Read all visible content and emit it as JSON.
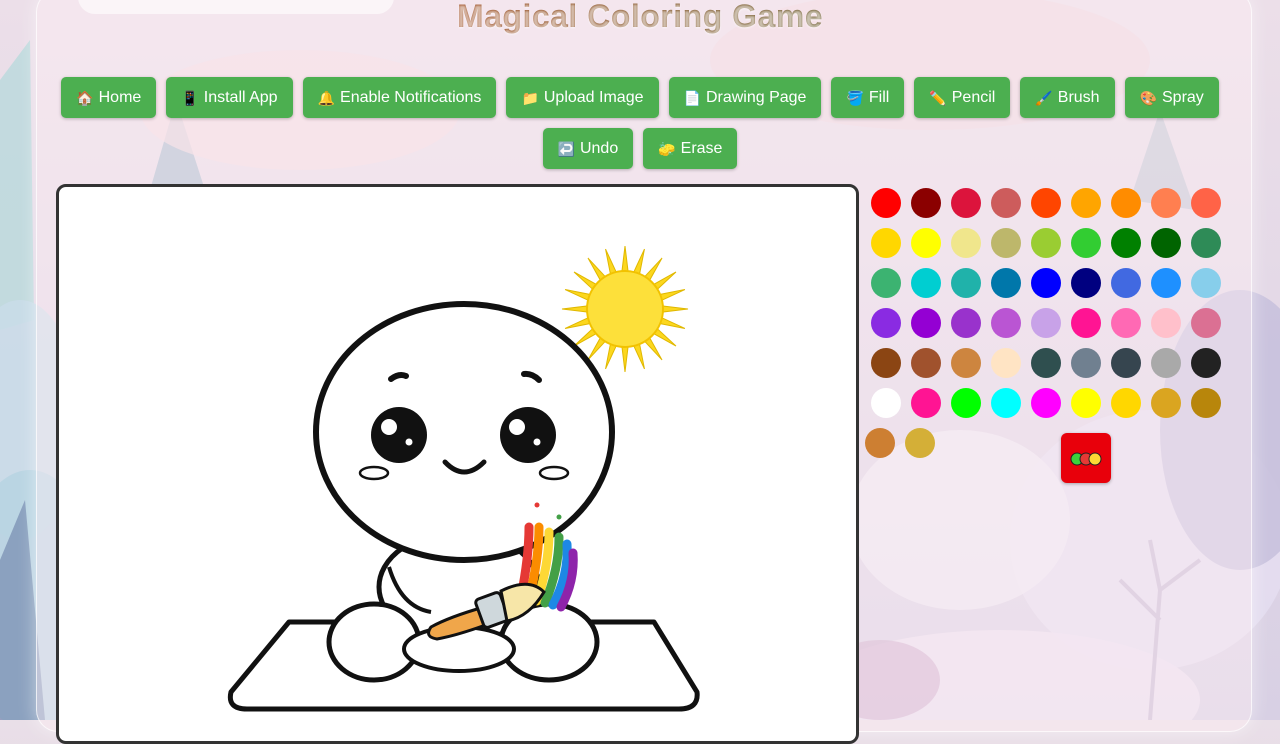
{
  "app": {
    "title": "Magical Coloring Game"
  },
  "toolbar": {
    "row1": [
      {
        "icon": "🏠",
        "icon_name": "house-icon",
        "label": "Home",
        "name": "home-button"
      },
      {
        "icon": "📱",
        "icon_name": "phone-icon",
        "label": "Install App",
        "name": "install-app-button"
      },
      {
        "icon": "🔔",
        "icon_name": "bell-icon",
        "label": "Enable Notifications",
        "name": "enable-notifications-button"
      },
      {
        "icon": "📁",
        "icon_name": "folder-icon",
        "label": "Upload Image",
        "name": "upload-image-button"
      },
      {
        "icon": "📄",
        "icon_name": "page-icon",
        "label": "Drawing Page",
        "name": "drawing-page-button"
      },
      {
        "icon": "🪣",
        "icon_name": "bucket-icon",
        "label": "Fill",
        "name": "fill-button"
      },
      {
        "icon": "✏️",
        "icon_name": "pencil-icon",
        "label": "Pencil",
        "name": "pencil-button"
      },
      {
        "icon": "🖌️",
        "icon_name": "brush-icon",
        "label": "Brush",
        "name": "brush-button"
      },
      {
        "icon": "🎨",
        "icon_name": "palette-icon",
        "label": "Spray",
        "name": "spray-button"
      }
    ],
    "row2": [
      {
        "icon": "↩️",
        "icon_name": "undo-icon",
        "label": "Undo",
        "name": "undo-button"
      },
      {
        "icon": "🧽",
        "icon_name": "sponge-icon",
        "label": "Erase",
        "name": "erase-button"
      }
    ]
  },
  "palette": {
    "colors": [
      "#ff0000",
      "#8b0000",
      "#dc143c",
      "#cd5c5c",
      "#ff4500",
      "#ffa500",
      "#ff8c00",
      "#ff7f50",
      "#ff6347",
      "#ffd700",
      "#ffff00",
      "#f0e68c",
      "#bdb76b",
      "#9acd32",
      "#32cd32",
      "#008000",
      "#006400",
      "#2e8b57",
      "#3cb371",
      "#00ced1",
      "#20b2aa",
      "#0077aa",
      "#0000ff",
      "#000080",
      "#4169e1",
      "#1e90ff",
      "#87ceeb",
      "#8a2be2",
      "#9400d3",
      "#9932cc",
      "#ba55d3",
      "#c8a2e8",
      "#ff1493",
      "#ff69b4",
      "#ffc0cb",
      "#db7093",
      "#8b4513",
      "#a0522d",
      "#cd853f",
      "#ffe4c4",
      "#2f4f4f",
      "#708090",
      "#36454f",
      "#a9a9a9",
      "#222222",
      "#ffffff",
      "#ff1493",
      "#00ff00",
      "#00ffff",
      "#ff00ff",
      "#ffff00",
      "#ffd700",
      "#daa520",
      "#b8860b",
      "#cd7f32",
      "#d4af37"
    ],
    "custom_picker_icon": "color-picker-icon"
  },
  "canvas": {
    "image_name": "cute-character-with-rainbow-brush-coloring-page"
  }
}
